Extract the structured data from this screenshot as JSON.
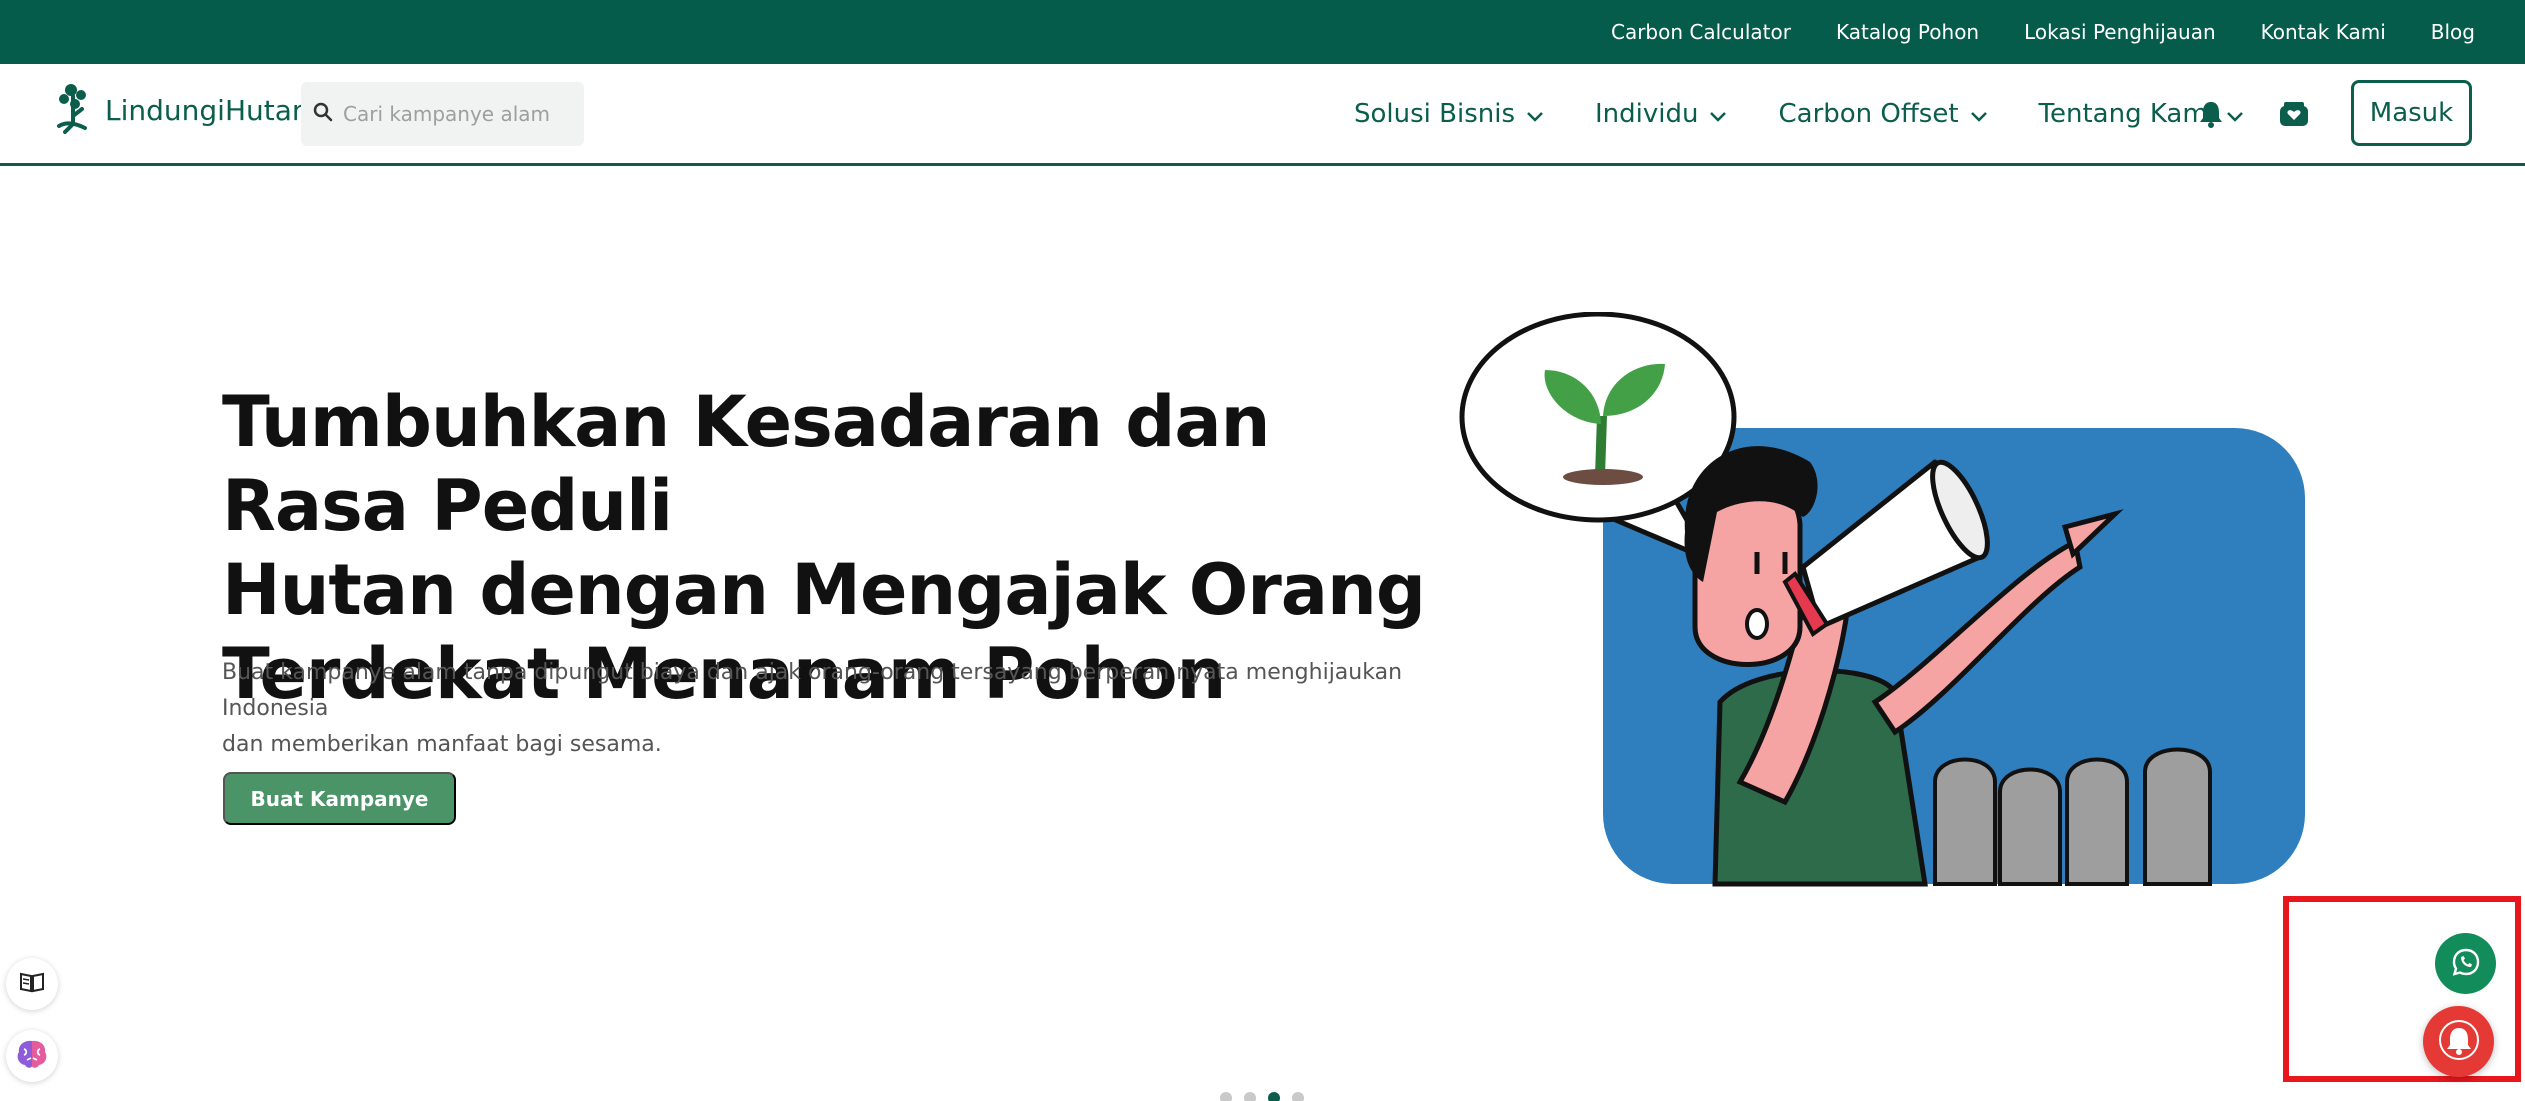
{
  "topbar": {
    "links": [
      "Carbon Calculator",
      "Katalog Pohon",
      "Lokasi Penghijauan",
      "Kontak Kami",
      "Blog"
    ]
  },
  "header": {
    "logo_text": "LindungiHutan",
    "search_placeholder": "Cari kampanye alam",
    "nav": [
      "Solusi Bisnis",
      "Individu",
      "Carbon Offset",
      "Tentang Kami"
    ],
    "login_label": "Masuk"
  },
  "hero": {
    "title_lines": [
      "Tumbuhkan Kesadaran dan Rasa Peduli",
      "Hutan dengan Mengajak Orang",
      "Terdekat Menanam Pohon"
    ],
    "subtitle_lines": [
      "Buat kampanye alam tanpa dipungut biaya dan ajak orang-orang tersayang berperan nyata menghijaukan Indonesia",
      "dan memberikan manfaat bagi sesama."
    ],
    "cta_label": "Buat Kampanye"
  },
  "carousel": {
    "slide_count": 4,
    "active_index": 2
  },
  "colors": {
    "brand_dark": "#065c4b",
    "brand_button": "#4b9467",
    "illustration_blue": "#2f7fbf",
    "whatsapp": "#128c5a",
    "notification": "#e53935",
    "highlight": "#e8161d"
  }
}
